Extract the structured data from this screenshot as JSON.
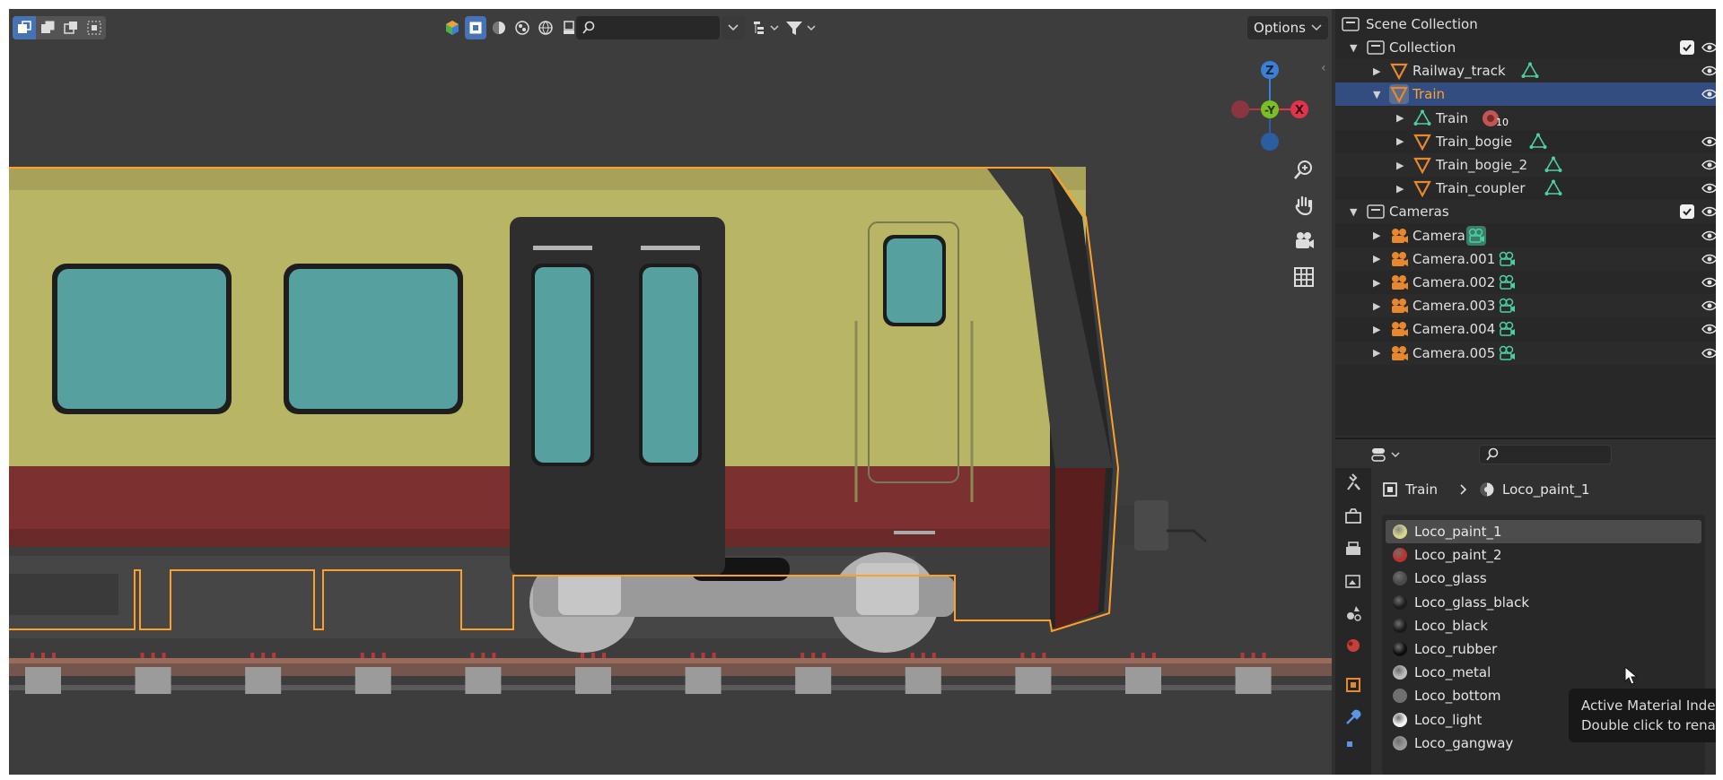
{
  "viewport": {
    "options_label": "Options",
    "search_placeholder": "",
    "gizmo_axes": {
      "z": "Z",
      "neg_y": "-Y",
      "x": "X"
    },
    "colors": {
      "accent": "#4772b3",
      "selection_outline": "#ff9f2a",
      "train_yellow": "#b8b565",
      "train_red": "#7d3030",
      "window_teal": "#56a0a0"
    }
  },
  "outliner": {
    "title": "Scene Collection",
    "rows": [
      {
        "label": "Collection",
        "type": "collection"
      },
      {
        "label": "Railway_track",
        "type": "object"
      },
      {
        "label": "Train",
        "type": "object",
        "selected": true
      },
      {
        "label": "Train",
        "type": "mesh-data",
        "badge": "10"
      },
      {
        "label": "Train_bogie",
        "type": "object"
      },
      {
        "label": "Train_bogie_2",
        "type": "object"
      },
      {
        "label": "Train_coupler",
        "type": "object"
      },
      {
        "label": "Cameras",
        "type": "collection"
      },
      {
        "label": "Camera",
        "type": "camera"
      },
      {
        "label": "Camera.001",
        "type": "camera"
      },
      {
        "label": "Camera.002",
        "type": "camera"
      },
      {
        "label": "Camera.003",
        "type": "camera"
      },
      {
        "label": "Camera.004",
        "type": "camera"
      },
      {
        "label": "Camera.005",
        "type": "camera"
      }
    ]
  },
  "properties": {
    "search_placeholder": "",
    "breadcrumb": {
      "object": "Train",
      "material": "Loco_paint_1"
    },
    "materials": [
      {
        "name": "Loco_paint_1",
        "color": "#d8d58a",
        "active": true
      },
      {
        "name": "Loco_paint_2",
        "color": "#c0302a"
      },
      {
        "name": "Loco_glass",
        "color": "#4a4a4a"
      },
      {
        "name": "Loco_glass_black",
        "color": "#1c1c1c"
      },
      {
        "name": "Loco_black",
        "color": "#1a1a1a"
      },
      {
        "name": "Loco_rubber",
        "color": "#0d0d0d"
      },
      {
        "name": "Loco_metal",
        "color": "#bdbdbd"
      },
      {
        "name": "Loco_bottom",
        "color": "#707070"
      },
      {
        "name": "Loco_light",
        "color": "#f4f4f4"
      },
      {
        "name": "Loco_gangway",
        "color": "#9a9a9a"
      }
    ]
  },
  "tooltip": {
    "line1": "Active Material Index",
    "line2": "Double click to rename."
  }
}
